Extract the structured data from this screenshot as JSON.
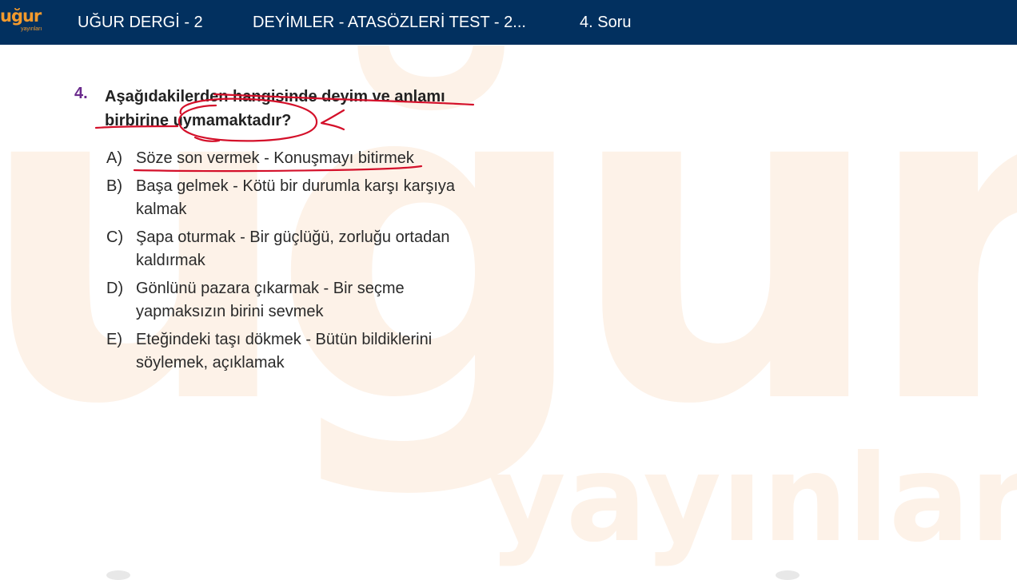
{
  "header": {
    "logo_text": "uğur",
    "logo_sub": "yayınları",
    "nav": [
      "UĞUR DERGİ - 2",
      "DEYİMLER - ATASÖZLERİ TEST - 2...",
      "4. Soru"
    ]
  },
  "watermark": {
    "word_big": "uğur",
    "word_sub": "yayınları"
  },
  "question": {
    "number": "4.",
    "stem": "Aşağıdakilerden hangisinde deyim ve anlamı birbirine uymamaktadır?",
    "options": [
      {
        "letter": "A)",
        "text": "Söze son vermek - Konuşmayı bitirmek"
      },
      {
        "letter": "B)",
        "text": "Başa gelmek - Kötü bir durumla karşı karşıya kalmak"
      },
      {
        "letter": "C)",
        "text": "Şapa oturmak - Bir güçlüğü, zorluğu ortadan kaldırmak"
      },
      {
        "letter": "D)",
        "text": "Gönlünü pazara çıkarmak - Bir seçme yapmaksızın birini sevmek"
      },
      {
        "letter": "E)",
        "text": "Eteğindeki taşı dökmek - Bütün bildiklerini söylemek, açıklamak"
      }
    ]
  },
  "colors": {
    "header_bg": "#02305f",
    "logo_orange": "#f39a2d",
    "number_purple": "#6a2a8c",
    "annotation_red": "#d4102a",
    "watermark": "#fdf0e4"
  }
}
